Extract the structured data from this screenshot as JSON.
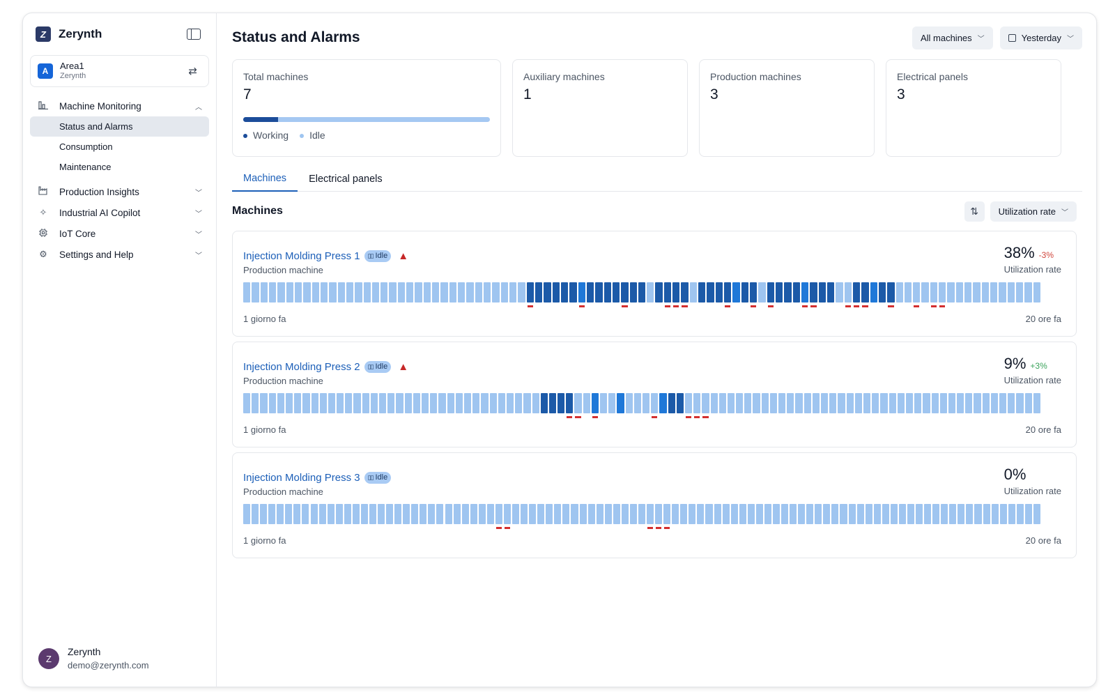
{
  "brand": {
    "name": "Zerynth",
    "logo_letter": "Z"
  },
  "area": {
    "avatar": "A",
    "name": "Area1",
    "org": "Zerynth"
  },
  "nav": {
    "groups": [
      {
        "label": "Machine Monitoring",
        "icon": "bar-chart-icon",
        "expanded": true,
        "items": [
          {
            "label": "Status and Alarms",
            "active": true
          },
          {
            "label": "Consumption",
            "active": false
          },
          {
            "label": "Maintenance",
            "active": false
          }
        ]
      },
      {
        "label": "Production Insights",
        "icon": "factory-icon",
        "expanded": false
      },
      {
        "label": "Industrial AI Copilot",
        "icon": "sparkles-icon",
        "expanded": false
      },
      {
        "label": "IoT Core",
        "icon": "chip-icon",
        "expanded": false
      },
      {
        "label": "Settings and Help",
        "icon": "gear-icon",
        "expanded": false
      }
    ]
  },
  "user": {
    "initial": "Z",
    "name": "Zerynth",
    "email": "demo@zerynth.com"
  },
  "header": {
    "title": "Status and Alarms",
    "machine_filter": "All machines",
    "date_filter": "Yesterday"
  },
  "stats": {
    "total": {
      "label": "Total machines",
      "value": "7",
      "working_fraction": 0.14,
      "legend_working": "Working",
      "legend_idle": "Idle"
    },
    "auxiliary": {
      "label": "Auxiliary machines",
      "value": "1"
    },
    "production": {
      "label": "Production machines",
      "value": "3"
    },
    "panels": {
      "label": "Electrical panels",
      "value": "3"
    }
  },
  "tabs": [
    {
      "label": "Machines",
      "active": true
    },
    {
      "label": "Electrical panels",
      "active": false
    }
  ],
  "machines_section": {
    "title": "Machines",
    "sort_label": "Utilization rate"
  },
  "colors": {
    "idle": "#9fc5f0",
    "working": "#1c5aa8",
    "setup": "#1f78d8",
    "alarm": "#d32f2f",
    "delta_neg": "#d0453b",
    "delta_pos": "#3aa35b"
  },
  "machines": [
    {
      "name": "Injection Molding Press 1",
      "status": "Idle",
      "has_alarm": true,
      "type": "Production machine",
      "utilization": "38%",
      "delta": "-3%",
      "delta_positive": false,
      "util_label": "Utilization rate",
      "start_label": "1 giorno fa",
      "end_label": "20 ore fa",
      "timeline": "IIIIIIIIIIIIIIIIIIIIIIIIIIIIIIIIIWWWWWWBWWWWWWWIWWWWIWWWWBWWIWWWWBWWWIIWWBWWIIIIIIIIIIIIIIIII",
      "alarms": [
        33,
        39,
        44,
        49,
        50,
        51,
        56,
        59,
        61,
        65,
        66,
        70,
        71,
        72,
        75,
        78,
        80,
        81
      ]
    },
    {
      "name": "Injection Molding Press 2",
      "status": "Idle",
      "has_alarm": true,
      "type": "Production machine",
      "utilization": "9%",
      "delta": "+3%",
      "delta_positive": true,
      "util_label": "Utilization rate",
      "start_label": "1 giorno fa",
      "end_label": "20 ore fa",
      "timeline": "IIIIIIIIIIIIIIIIIIIIIIIIIIIIIIIIIIIWWWWIIBIIBIIIIBWWIIIIIIIIIIIIIIIIIIIIIIIIIIIIIIIIIIIIIIIIII",
      "alarms": [
        38,
        39,
        41,
        48,
        52,
        53,
        54
      ]
    },
    {
      "name": "Injection Molding Press 3",
      "status": "Idle",
      "has_alarm": false,
      "type": "Production machine",
      "utilization": "0%",
      "delta": "",
      "delta_positive": true,
      "util_label": "Utilization rate",
      "start_label": "1 giorno fa",
      "end_label": "20 ore fa",
      "timeline": "IIIIIIIIIIIIIIIIIIIIIIIIIIIIIIIIIIIIIIIIIIIIIIIIIIIIIIIIIIIIIIIIIIIIIIIIIIIIIIIIIIIIIIIIIIIIIII",
      "alarms": [
        30,
        31,
        48,
        49,
        50
      ]
    }
  ]
}
